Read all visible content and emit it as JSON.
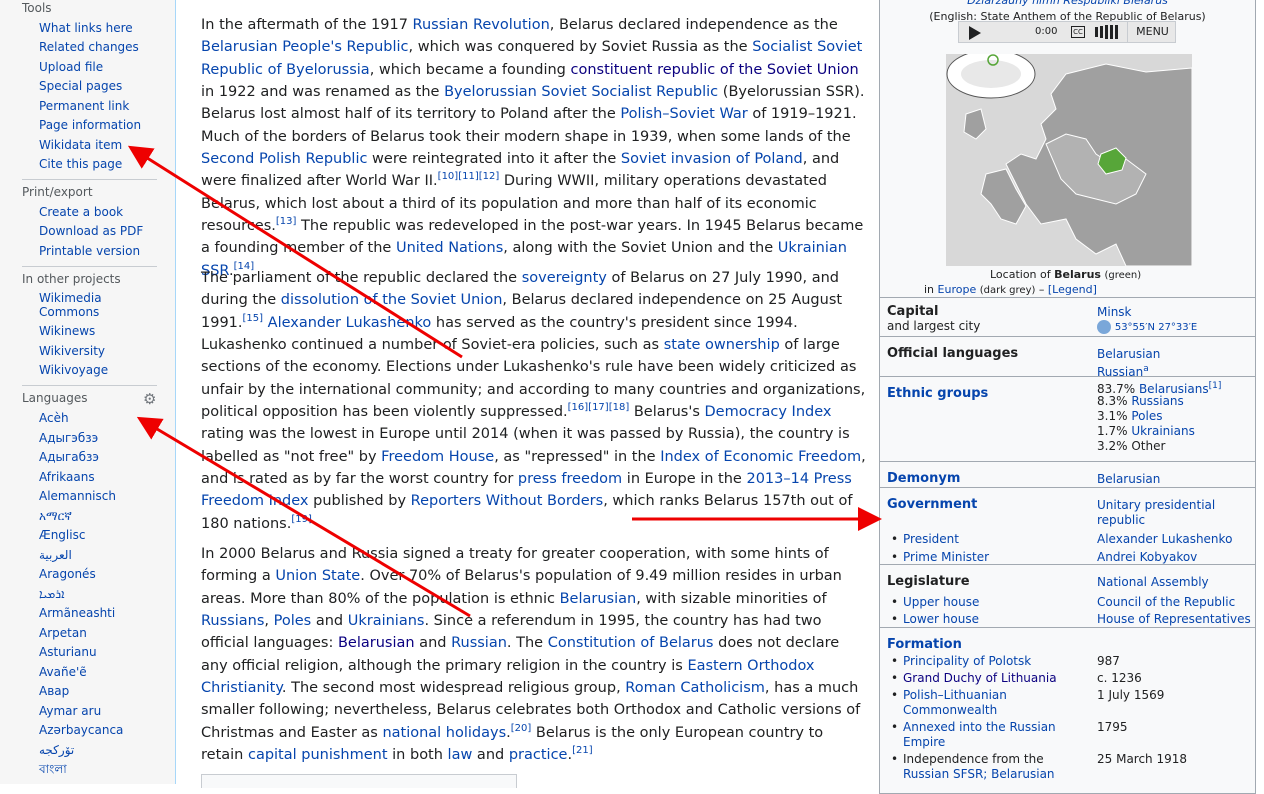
{
  "sidebar": {
    "tools_heading": "Tools",
    "tools": [
      "What links here",
      "Related changes",
      "Upload file",
      "Special pages",
      "Permanent link",
      "Page information",
      "Wikidata item",
      "Cite this page"
    ],
    "print_heading": "Print/export",
    "print": [
      "Create a book",
      "Download as PDF",
      "Printable version"
    ],
    "projects_heading": "In other projects",
    "projects": [
      "Wikimedia Commons",
      "Wikinews",
      "Wikiversity",
      "Wikivoyage"
    ],
    "languages_heading": "Languages",
    "languages": [
      "Acèh",
      "Адыгэбзэ",
      "Адыгабзэ",
      "Afrikaans",
      "Alemannisch",
      "አማርኛ",
      "Ænglisc",
      "العربية",
      "Aragonés",
      "ܐܪܡܝܐ",
      "Armãneashti",
      "Arpetan",
      "Asturianu",
      "Avañe'ẽ",
      "Авар",
      "Aymar aru",
      "Azərbaycanca",
      "تۆرکجه",
      "বাংলা"
    ]
  },
  "article": {
    "p1": [
      {
        "t": "In the aftermath of the 1917 "
      },
      {
        "t": "Russian Revolution",
        "l": 1
      },
      {
        "t": ", Belarus declared independence as the "
      },
      {
        "t": "Belarusian People's Republic",
        "l": 1
      },
      {
        "t": ", which was conquered by Soviet Russia as the "
      },
      {
        "t": "Socialist Soviet Republic of Byelorussia",
        "l": 1
      },
      {
        "t": ", which became a founding "
      },
      {
        "t": "constituent republic of the Soviet Union",
        "l": 2
      },
      {
        "t": " in 1922 and was renamed as the "
      },
      {
        "t": "Byelorussian Soviet Socialist Republic",
        "l": 1
      },
      {
        "t": " (Byelorussian SSR). Belarus lost almost half of its territory to Poland after the "
      },
      {
        "t": "Polish–Soviet War",
        "l": 1
      },
      {
        "t": " of 1919–1921. Much of the borders of Belarus took their modern shape in 1939, when some lands of the "
      },
      {
        "t": "Second Polish Republic",
        "l": 1
      },
      {
        "t": " were reintegrated into it after the "
      },
      {
        "t": "Soviet invasion of Poland",
        "l": 1
      },
      {
        "t": ", and were finalized after World War II."
      },
      {
        "s": "[10][11][12]"
      },
      {
        "t": " During WWII, military operations devastated Belarus, which lost about a third of its population and more than half of its economic resources."
      },
      {
        "s": "[13]"
      },
      {
        "t": " The republic was redeveloped in the post-war years. In 1945 Belarus became a founding member of the "
      },
      {
        "t": "United Nations",
        "l": 1
      },
      {
        "t": ", along with the Soviet Union and the "
      },
      {
        "t": "Ukrainian SSR",
        "l": 1
      },
      {
        "t": "."
      },
      {
        "s": "[14]"
      }
    ],
    "p2": [
      {
        "t": "The parliament of the republic declared the "
      },
      {
        "t": "sovereignty",
        "l": 1
      },
      {
        "t": " of Belarus on 27 July 1990, and during the "
      },
      {
        "t": "dissolution of the Soviet Union",
        "l": 1
      },
      {
        "t": ", Belarus declared independence on 25 August 1991."
      },
      {
        "s": "[15]"
      },
      {
        "t": " "
      },
      {
        "t": "Alexander Lukashenko",
        "l": 1
      },
      {
        "t": " has served as the country's president since 1994. Lukashenko continued a number of Soviet-era policies, such as "
      },
      {
        "t": "state ownership",
        "l": 1
      },
      {
        "t": " of large sections of the economy. Elections under Lukashenko's rule have been widely criticized as unfair by the international community; and according to many countries and organizations, political opposition has been violently suppressed."
      },
      {
        "s": "[16][17][18]"
      },
      {
        "t": " Belarus's "
      },
      {
        "t": "Democracy Index",
        "l": 1
      },
      {
        "t": " rating was the lowest in Europe until 2014 (when it was passed by Russia), the country is labelled as \"not free\" by "
      },
      {
        "t": "Freedom House",
        "l": 1
      },
      {
        "t": ", as \"repressed\" in the "
      },
      {
        "t": "Index of Economic Freedom",
        "l": 1
      },
      {
        "t": ", and is rated as by far the worst country for "
      },
      {
        "t": "press freedom",
        "l": 1
      },
      {
        "t": " in Europe in the "
      },
      {
        "t": "2013–14 Press Freedom Index",
        "l": 1
      },
      {
        "t": " published by "
      },
      {
        "t": "Reporters Without Borders",
        "l": 1
      },
      {
        "t": ", which ranks Belarus 157th out of 180 nations."
      },
      {
        "s": "[19]"
      }
    ],
    "p3": [
      {
        "t": "In 2000 Belarus and Russia signed a treaty for greater cooperation, with some hints of forming a "
      },
      {
        "t": "Union State",
        "l": 1
      },
      {
        "t": ". Over 70% of Belarus's population of 9.49 million resides in urban areas. More than 80% of the population is ethnic "
      },
      {
        "t": "Belarusian",
        "l": 1
      },
      {
        "t": ", with sizable minorities of "
      },
      {
        "t": "Russians",
        "l": 1
      },
      {
        "t": ", "
      },
      {
        "t": "Poles",
        "l": 1
      },
      {
        "t": " and "
      },
      {
        "t": "Ukrainians",
        "l": 1
      },
      {
        "t": ". Since a referendum in 1995, the country has had two official languages: "
      },
      {
        "t": "Belarusian",
        "l": 2
      },
      {
        "t": " and "
      },
      {
        "t": "Russian",
        "l": 1
      },
      {
        "t": ". The "
      },
      {
        "t": "Constitution of Belarus",
        "l": 1
      },
      {
        "t": " does not declare any official religion, although the primary religion in the country is "
      },
      {
        "t": "Eastern Orthodox Christianity",
        "l": 1
      },
      {
        "t": ". The second most widespread religious group, "
      },
      {
        "t": "Roman Catholicism",
        "l": 1
      },
      {
        "t": ", has a much smaller following; nevertheless, Belarus celebrates both Orthodox and Catholic versions of Christmas and Easter as "
      },
      {
        "t": "national holidays",
        "l": 1
      },
      {
        "t": "."
      },
      {
        "s": "[20]"
      },
      {
        "t": " Belarus is the only European country to retain "
      },
      {
        "t": "capital punishment",
        "l": 1
      },
      {
        "t": " in both "
      },
      {
        "t": "law",
        "l": 1
      },
      {
        "t": " and "
      },
      {
        "t": "practice",
        "l": 1
      },
      {
        "t": "."
      },
      {
        "s": "[21]"
      }
    ]
  },
  "infobox": {
    "anthem_title": "Dziaržaŭny himn Respubliki Biełaruś",
    "anthem_english": "(English: State Anthem of the Republic of Belarus)",
    "player_time": "0:00",
    "player_cc": "CC",
    "player_menu": "MENU",
    "map_caption_1": "Location of",
    "map_caption_bold": "Belarus",
    "map_caption_green": "(green)",
    "map_caption_in": "in",
    "map_caption_europe": "Europe",
    "map_caption_grey": "(dark grey)",
    "map_caption_dash": "–",
    "map_caption_legend": "[Legend]",
    "capital_label": "Capital",
    "capital_sub": "and largest city",
    "capital_value": "Minsk",
    "capital_coords": "53°55′N 27°33′E",
    "official_languages_label": "Official languages",
    "official_languages": [
      "Belarusian",
      "Russian"
    ],
    "official_languages_note": "a",
    "ethnic_label": "Ethnic groups",
    "ethnic_groups": [
      {
        "pct": "83.7%",
        "name": "Belarusians",
        "ref": "[1]"
      },
      {
        "pct": "8.3%",
        "name": "Russians"
      },
      {
        "pct": "3.1%",
        "name": "Poles"
      },
      {
        "pct": "1.7%",
        "name": "Ukrainians"
      },
      {
        "pct": "3.2%",
        "name": "Other",
        "plain": true
      }
    ],
    "demonym_label": "Demonym",
    "demonym_value": "Belarusian",
    "government_label": "Government",
    "government_value_1": "Unitary presidential",
    "government_value_2": "republic",
    "president_label": "President",
    "president_value": "Alexander Lukashenko",
    "pm_label": "Prime Minister",
    "pm_value": "Andrei Kobyakov",
    "legislature_label": "Legislature",
    "legislature_value": "National Assembly",
    "upper_house_label": "Upper house",
    "upper_house_value": "Council of the Republic",
    "lower_house_label": "Lower house",
    "lower_house_value": "House of Representatives",
    "formation_label": "Formation",
    "formation": [
      {
        "label": "Principality of Polotsk",
        "value": "987"
      },
      {
        "label": "Grand Duchy of Lithuania",
        "value": "c. 1236"
      },
      {
        "label": "Polish–Lithuanian",
        "label2": "Commonwealth",
        "value": "1 July 1569"
      },
      {
        "label": "Annexed into the Russian",
        "label2": "Empire",
        "value": "1795"
      },
      {
        "label": "Independence from the",
        "label2": "Russian SFSR; Belarusian",
        "value": "25 March 1918"
      }
    ]
  },
  "colors": {
    "link": "#0645ad",
    "visited": "#0b0080",
    "arrow": "#ee0000",
    "sidebar": "#f6f6f6",
    "infobox": "#f8f9fa",
    "belarus": "#57a639",
    "land": "#a0a0a0",
    "sea": "#d8d8d8"
  }
}
